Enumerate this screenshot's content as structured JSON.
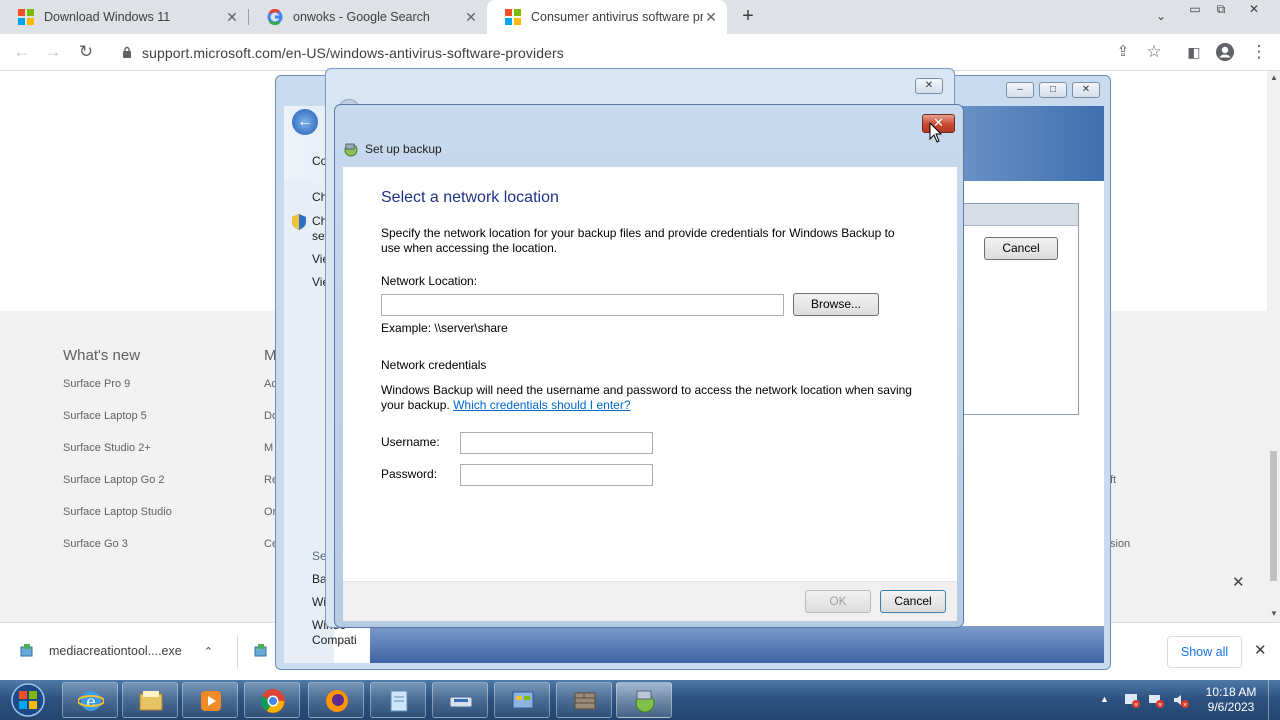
{
  "browser": {
    "tabs": [
      {
        "title": "Download Windows 11",
        "icon": "microsoft-logo-icon"
      },
      {
        "title": "onwoks - Google Search",
        "icon": "google-logo-icon"
      },
      {
        "title": "Consumer antivirus software pro",
        "icon": "microsoft-logo-icon",
        "active": true
      }
    ],
    "url": "support.microsoft.com/en-US/windows-antivirus-software-providers"
  },
  "page": {
    "footer": {
      "whats_new_title": "What's new",
      "col2_title_fragment": "M",
      "links": [
        "Surface Pro 9",
        "Surface Laptop 5",
        "Surface Studio 2+",
        "Surface Laptop Go 2",
        "Surface Laptop Studio",
        "Surface Go 3"
      ],
      "col2_fragments": [
        "Ac",
        "Do",
        "M",
        "Re",
        "Or",
        "Ce"
      ],
      "right_fragments": [
        "ft",
        "sion"
      ]
    }
  },
  "background_windows": {
    "sidebar_fragments": [
      "Co",
      "Ch",
      "Ch",
      "set",
      "Vie",
      "Vie",
      "Se",
      "Ba",
      "Wi",
      "Windo",
      "Compati"
    ],
    "cancel_label": "Cancel"
  },
  "dialog": {
    "title": "Set up backup",
    "heading": "Select a network location",
    "description": "Specify the network location for your backup files and provide credentials for Windows Backup to use when accessing the location.",
    "network_location_label": "Network Location:",
    "network_location_value": "",
    "browse_label": "Browse...",
    "example": "Example: \\\\server\\share",
    "credentials_heading": "Network credentials",
    "credentials_text": "Windows Backup will need the username and password to access the network location when saving your backup.",
    "credentials_link": "Which credentials should I enter?",
    "username_label": "Username:",
    "username_value": "",
    "password_label": "Password:",
    "password_value": "",
    "ok_label": "OK",
    "cancel_label": "Cancel",
    "close_glyph": "✕"
  },
  "downloads": {
    "item": "mediacreationtool....exe",
    "show_all": "Show all"
  },
  "taskbar": {
    "time": "10:18 AM",
    "date": "9/6/2023",
    "apps": [
      "internet-explorer-icon",
      "file-explorer-icon",
      "media-player-icon",
      "chrome-icon",
      "firefox-icon",
      "notepad-icon",
      "scanner-icon",
      "control-panel-icon",
      "firewall-icon",
      "backup-icon"
    ]
  }
}
